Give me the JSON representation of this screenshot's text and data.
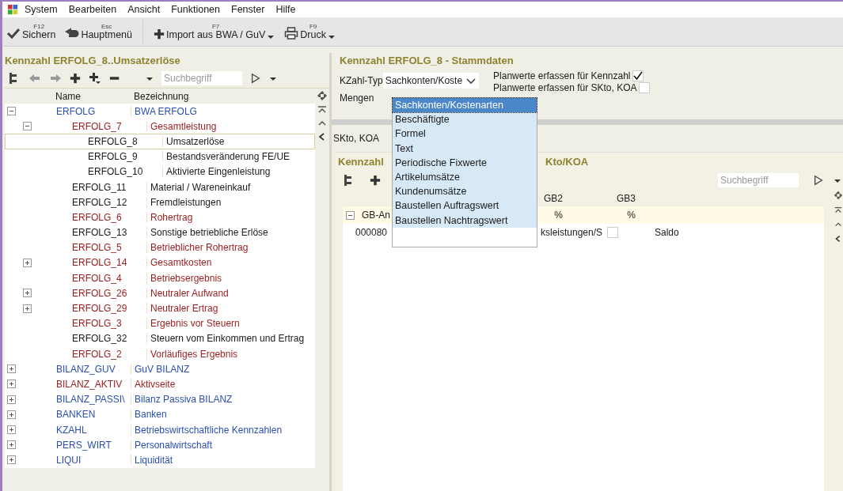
{
  "menu_bar": [
    "System",
    "Bearbeiten",
    "Ansicht",
    "Funktionen",
    "Fenster",
    "Hilfe"
  ],
  "toolbar": [
    {
      "kind": "save",
      "shortcut": "F12",
      "label": "Sichern",
      "has_menu": false
    },
    {
      "kind": "back",
      "shortcut": "Esc",
      "label": "Hauptmenü",
      "has_menu": false
    },
    {
      "kind": "add",
      "shortcut": "F7",
      "label": "Import aus BWA / GuV",
      "has_menu": true
    },
    {
      "kind": "print",
      "shortcut": "F9",
      "label": "Druck",
      "has_menu": true
    }
  ],
  "left_panel": {
    "title": "Kennzahl ERFOLG_8..Umsatzerlöse",
    "search": {
      "placeholder": "Suchbegriff"
    },
    "columns": [
      "Name",
      "Bezeichnung"
    ],
    "tree": [
      {
        "name": "ERFOLG",
        "label": "BWA ERFOLG",
        "color": "#2b4fb0",
        "selected": false,
        "expanded": true,
        "children": [
          {
            "name": "ERFOLG_7",
            "label": "Gesamtleistung",
            "color": "#9b1c1c",
            "selected": false,
            "expanded": true,
            "children": [
              {
                "name": "ERFOLG_8",
                "label": "Umsatzerlöse",
                "color": "#1a1a1a",
                "selected": true
              },
              {
                "name": "ERFOLG_9",
                "label": "Bestandsveränderung FE/UE",
                "color": "#1a1a1a",
                "selected": false
              },
              {
                "name": "ERFOLG_10",
                "label": "Aktivierte Eingenleistung",
                "color": "#1a1a1a",
                "selected": false
              }
            ]
          },
          {
            "name": "ERFOLG_11",
            "label": "Material / Wareneinkauf",
            "color": "#1a1a1a",
            "selected": false
          },
          {
            "name": "ERFOLG_12",
            "label": "Fremdleistungen",
            "color": "#1a1a1a",
            "selected": false
          },
          {
            "name": "ERFOLG_6",
            "label": "Rohertrag",
            "color": "#9b1c1c",
            "selected": false
          },
          {
            "name": "ERFOLG_13",
            "label": "Sonstige betriebliche Erlöse",
            "color": "#1a1a1a",
            "selected": false
          },
          {
            "name": "ERFOLG_5",
            "label": "Betrieblicher Rohertrag",
            "color": "#9b1c1c",
            "selected": false
          },
          {
            "name": "ERFOLG_14",
            "label": "Gesamtkosten",
            "color": "#9b1c1c",
            "selected": false,
            "expanded": false
          },
          {
            "name": "ERFOLG_4",
            "label": "Betriebsergebnis",
            "color": "#9b1c1c",
            "selected": false
          },
          {
            "name": "ERFOLG_26",
            "label": "Neutraler Aufwand",
            "color": "#9b1c1c",
            "selected": false,
            "expanded": false
          },
          {
            "name": "ERFOLG_29",
            "label": "Neutraler Ertrag",
            "color": "#9b1c1c",
            "selected": false,
            "expanded": false
          },
          {
            "name": "ERFOLG_3",
            "label": "Ergebnis vor Steuern",
            "color": "#9b1c1c",
            "selected": false
          },
          {
            "name": "ERFOLG_32",
            "label": "Steuern vom Einkommen und Ertrag",
            "color": "#1a1a1a",
            "selected": false
          },
          {
            "name": "ERFOLG_2",
            "label": "Vorläufiges Ergebnis",
            "color": "#9b1c1c",
            "selected": false
          }
        ]
      },
      {
        "name": "BILANZ_GUV",
        "label": "GuV BILANZ",
        "color": "#2b4fb0",
        "selected": false,
        "expanded": false
      },
      {
        "name": "BILANZ_AKTIV",
        "label": "Aktivseite",
        "color": "#9b1c1c",
        "selected": false,
        "expanded": false
      },
      {
        "name": "BILANZ_PASSI\\",
        "label": "Bilanz Passiva BILANZ",
        "color": "#2b4fb0",
        "selected": false,
        "expanded": false
      },
      {
        "name": "BANKEN",
        "label": "Banken",
        "color": "#2b4fb0",
        "selected": false,
        "expanded": false
      },
      {
        "name": "KZAHL",
        "label": "Betriebswirtschaftliche Kennzahlen",
        "color": "#2b4fb0",
        "selected": false,
        "expanded": false
      },
      {
        "name": "PERS_WIRT",
        "label": "Personalwirtschaft",
        "color": "#2b4fb0",
        "selected": false,
        "expanded": false
      },
      {
        "name": "LIQUI",
        "label": "Liquidität",
        "color": "#2b4fb0",
        "selected": false,
        "expanded": false
      }
    ]
  },
  "right_panel": {
    "title": "Kennzahl ERFOLG_8 - Stammdaten",
    "kzahl_typ": {
      "label": "KZahl-Typ",
      "value": "Sachkonten/Koste"
    },
    "mengen_label": "Mengen",
    "plan_checks": [
      {
        "label": "Planwerte erfassen für Kennzahl",
        "checked": true
      },
      {
        "label": "Planwerte erfassen für SKto, KOA",
        "checked": false
      }
    ],
    "dropdown_options": [
      {
        "label": "Sachkonten/Kostenarten",
        "selected": true
      },
      {
        "label": "Beschäftigte",
        "selected": false
      },
      {
        "label": "Formel",
        "selected": false
      },
      {
        "label": "Text",
        "selected": false
      },
      {
        "label": "Periodische Fixwerte",
        "selected": false
      },
      {
        "label": "Artikelumsätze",
        "selected": false
      },
      {
        "label": "Kundenumsätze",
        "selected": false
      },
      {
        "label": "Baustellen Auftragswert",
        "selected": false
      },
      {
        "label": "Baustellen Nachtragswert",
        "selected": false
      }
    ],
    "tab_label": "SKto, KOA",
    "sub_panel": {
      "title_left": "Kennzahl",
      "title_right": "Kto/KOA",
      "search": {
        "placeholder": "Suchbegriff"
      },
      "columns": [
        "GB2",
        "GB3"
      ],
      "rows": [
        {
          "expanded": true,
          "column_1": "GB-An",
          "gb2": "%",
          "gb3": "%"
        },
        {
          "column_1": "000080",
          "column_2": "ksleistungen/S",
          "checked": false,
          "column_4": "Saldo"
        }
      ]
    }
  }
}
